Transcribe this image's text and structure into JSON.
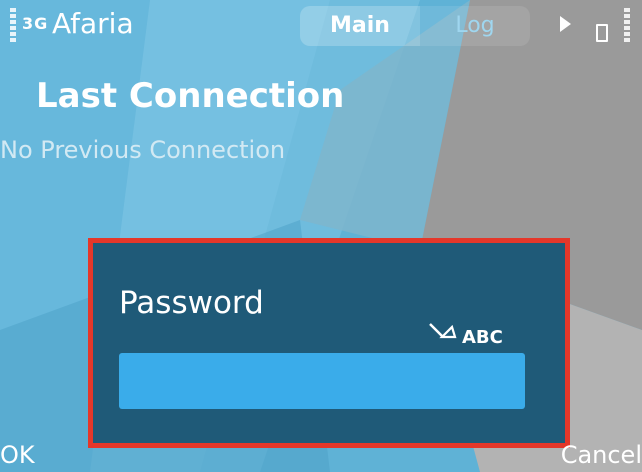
{
  "status_bar": {
    "network": "3G",
    "app_title": "Afaria",
    "tabs": [
      {
        "label": "Main",
        "active": true
      },
      {
        "label": "Log",
        "active": false
      }
    ]
  },
  "main": {
    "heading": "Last Connection",
    "subtext": "No Previous Connection"
  },
  "dialog": {
    "label": "Password",
    "input_mode": "ABC",
    "input_value": "",
    "highlight_color": "#e4372a"
  },
  "softkeys": {
    "left": "OK",
    "right": "Cancel"
  },
  "colors": {
    "dialog_bg": "#1f5a78",
    "input_bg": "#3aacea",
    "background": "#5fb2d6"
  },
  "icons": [
    "signal-strength-icon",
    "forward-arrow-icon",
    "battery-icon",
    "pen-input-icon"
  ]
}
